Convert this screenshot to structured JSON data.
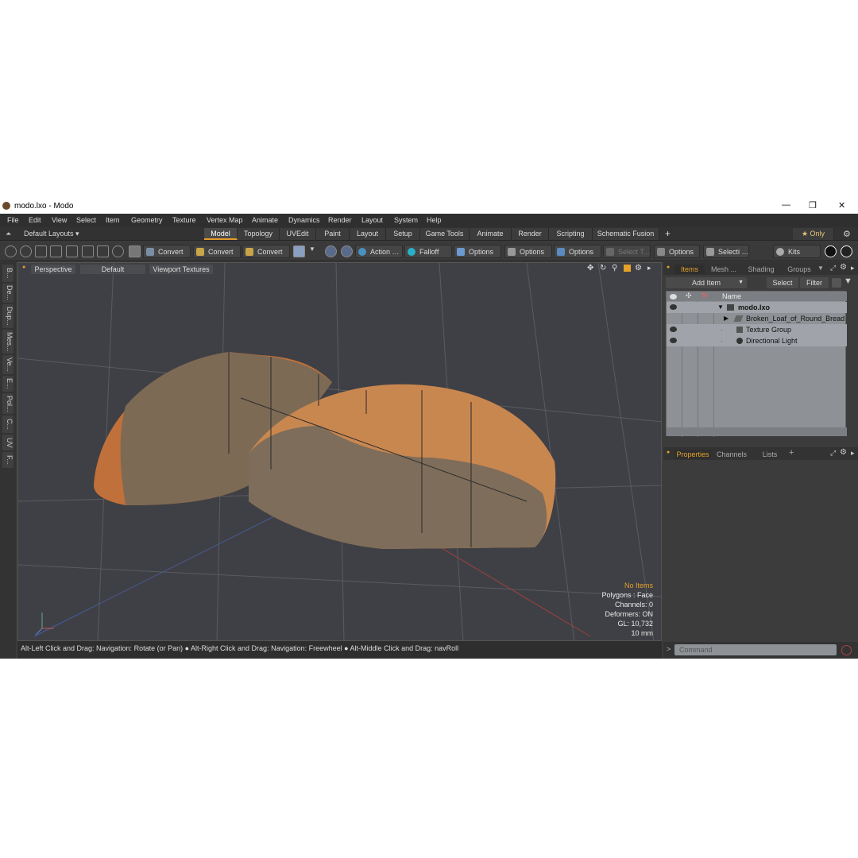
{
  "window": {
    "title": "modo.lxo - Modo",
    "controls": [
      "—",
      "❐",
      "✕"
    ]
  },
  "menu": [
    "File",
    "Edit",
    "View",
    "Select",
    "Item",
    "Geometry",
    "Texture",
    "Vertex Map",
    "Animate",
    "Dynamics",
    "Render",
    "Layout",
    "System",
    "Help"
  ],
  "layouts": {
    "label": "Default Layouts ▾",
    "tabs": [
      "Model",
      "Topology",
      "UVEdit",
      "Paint",
      "Layout",
      "Setup",
      "Game Tools",
      "Animate",
      "Render",
      "Scripting",
      "Schematic Fusion"
    ],
    "active": "Model",
    "add": "+",
    "only": "★ Only"
  },
  "toolbar": {
    "convert1": "Convert",
    "convert2": "Convert",
    "convert3": "Convert",
    "action": "Action  …",
    "falloff": "Falloff",
    "options1": "Options",
    "options2": "Options",
    "options3": "Options",
    "options4": "Options",
    "select": "Select T...",
    "selecti": "Selecti …",
    "kits": "Kits"
  },
  "left_tabs": [
    "B...",
    "De...",
    "Dup...",
    "Mes...",
    "Ve...",
    "E...",
    "Pol...",
    "C...",
    "UV",
    "F..."
  ],
  "viewport": {
    "perspective": "Perspective",
    "default": "Default",
    "textures": "Viewport Textures"
  },
  "stats": {
    "items": "No Items",
    "polygons": "Polygons : Face",
    "channels": "Channels: 0",
    "deformers": "Deformers: ON",
    "gl": "GL: 10,732",
    "units": "10 mm"
  },
  "status": "Alt-Left Click and Drag: Navigation: Rotate (or Pan) ● Alt-Right Click and Drag: Navigation: Freewheel ● Alt-Middle Click and Drag: navRoll",
  "items_panel": {
    "tabs": [
      "Items",
      "Mesh ...",
      "Shading",
      "Groups"
    ],
    "add_item": "Add Item",
    "select": "Select",
    "filter": "Filter",
    "name_header": "Name",
    "rows": [
      "modo.lxo",
      "Broken_Loaf_of_Round_Bread",
      "Texture Group",
      "Directional Light"
    ]
  },
  "props_panel": {
    "tabs": [
      "Properties",
      "Channels",
      "Lists"
    ],
    "add": "+"
  },
  "command": {
    "placeholder": "Command"
  }
}
